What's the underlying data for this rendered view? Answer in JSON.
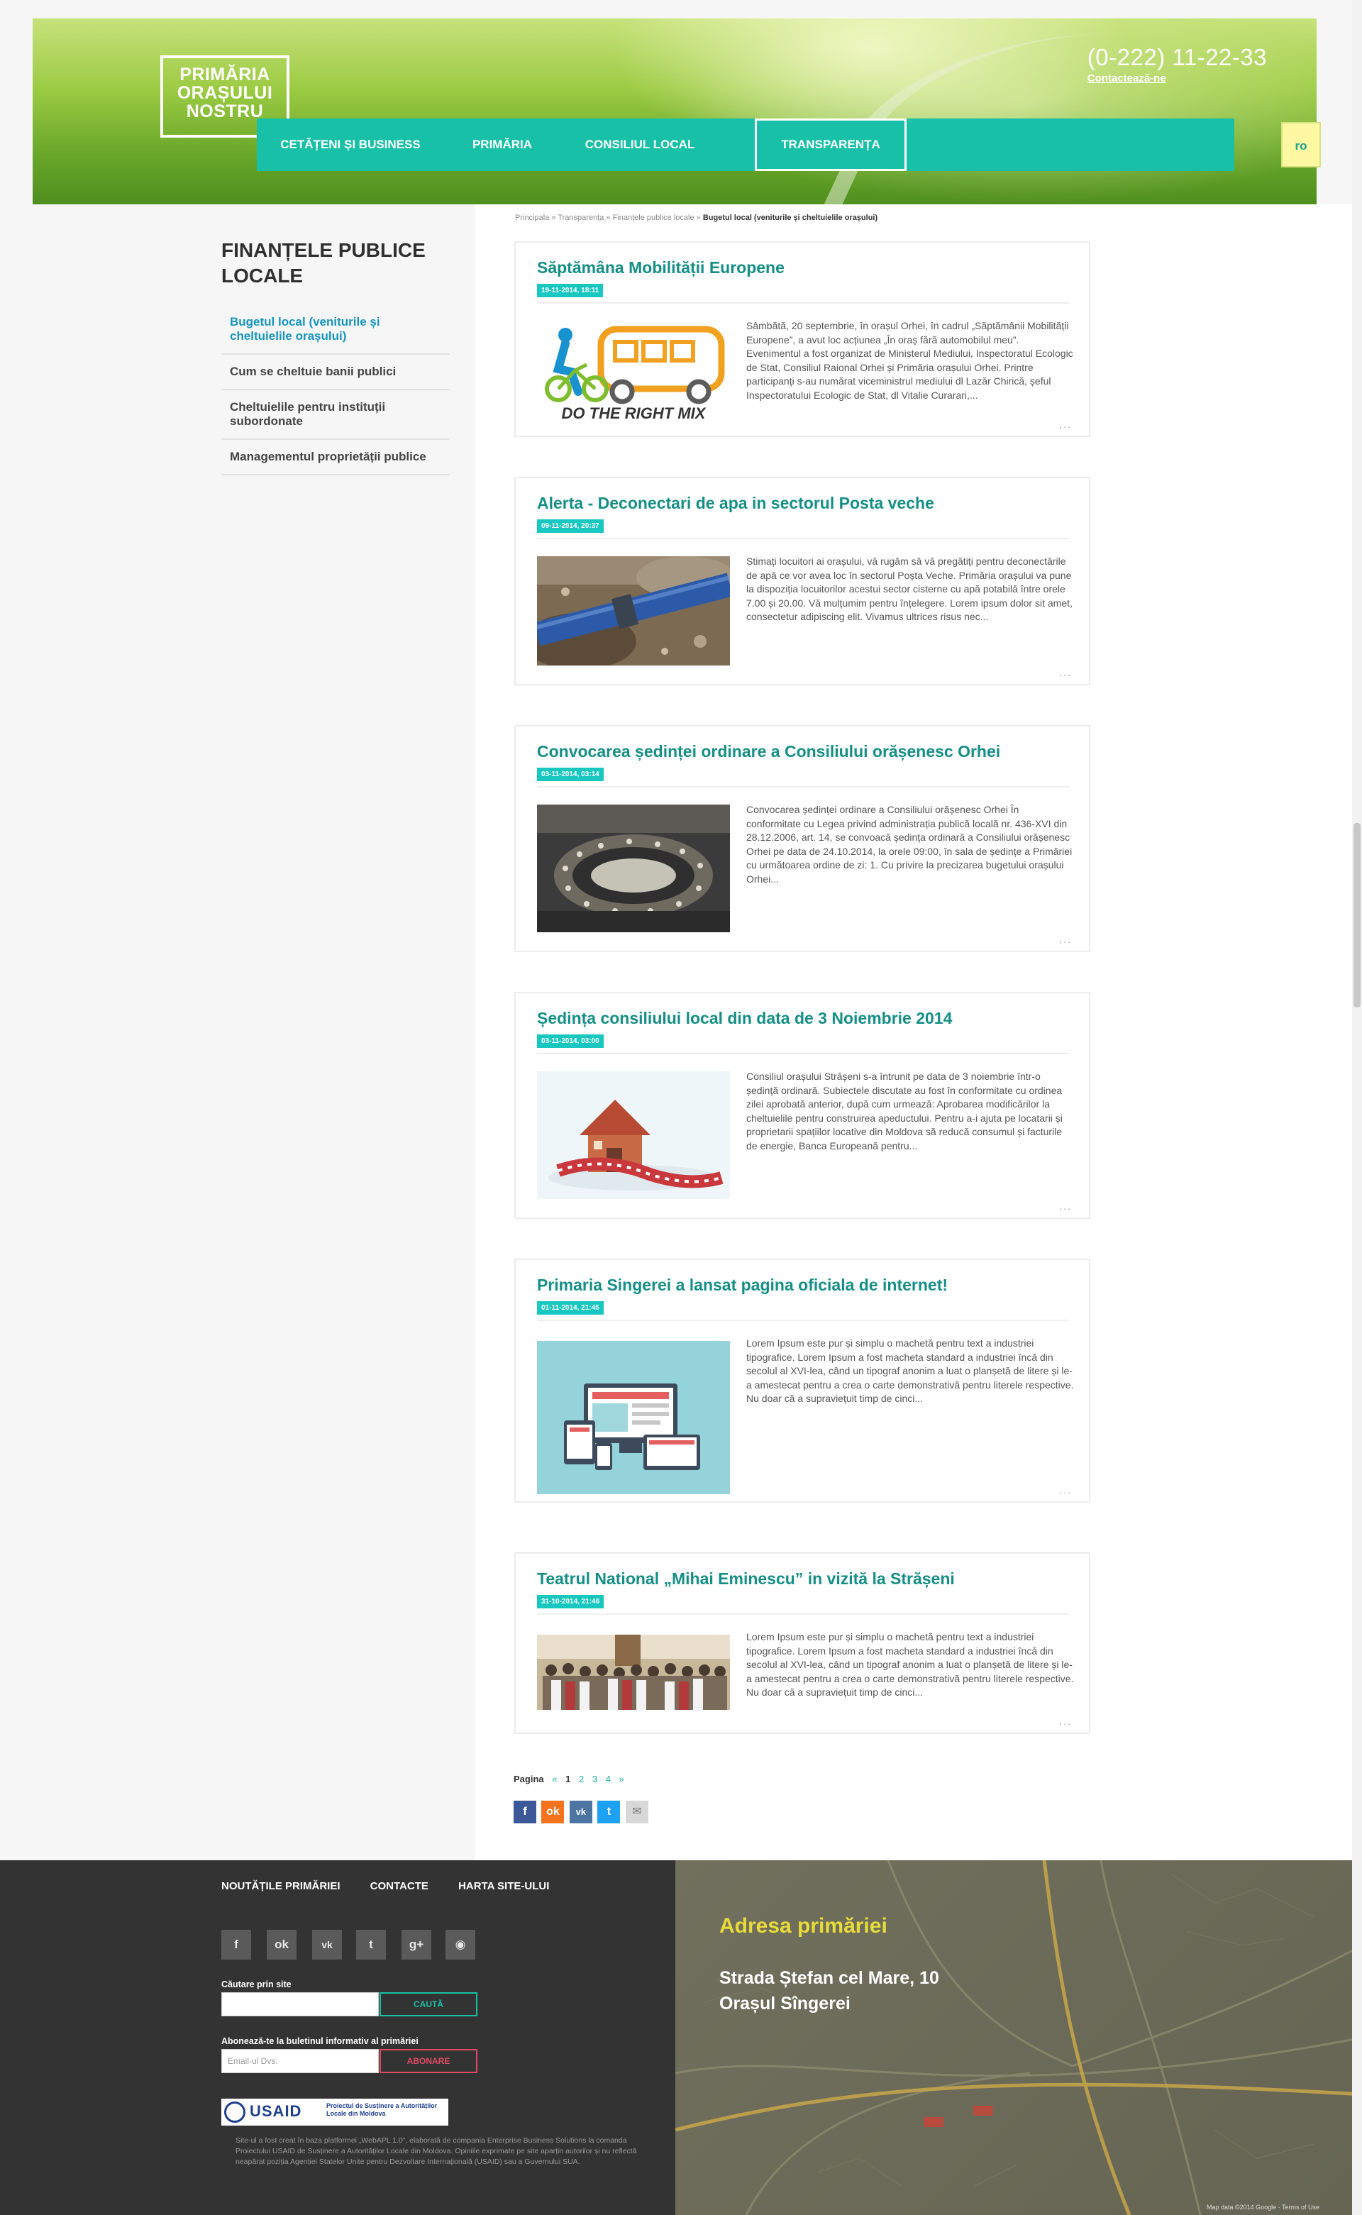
{
  "header": {
    "logo_line1": "PRIMĂRIA",
    "logo_line2": "ORAȘULUI",
    "logo_line3": "NOSTRU",
    "phone": "(0-222) 11-22-33",
    "contact_link": "Contactează-ne",
    "nav": [
      "CETĂȚENI ȘI BUSINESS",
      "PRIMĂRIA",
      "CONSILIUL LOCAL",
      "TRANSPARENȚA"
    ],
    "lang": "ro",
    "accent_color": "#17c0a6"
  },
  "breadcrumb": {
    "items": [
      "Principala",
      "Transparența",
      "Finanțele publice locale"
    ],
    "current": "Bugetul local (veniturile și cheltuielile orașului)"
  },
  "sidebar": {
    "title": "FINANȚELE PUBLICE LOCALE",
    "items": [
      "Bugetul local (veniturile și cheltuielile orașului)",
      "Cum se cheltuie banii publici",
      "Cheltuielile pentru instituții subordonate",
      "Managementul proprietății publice"
    ]
  },
  "articles": [
    {
      "title": "Săptămâna Mobilității Europene",
      "date": "19-11-2014, 18:11",
      "image_caption": "DO THE RIGHT MIX",
      "text": "Sâmbătă, 20 septembrie, în orașul Orhei, în cadrul „Săptămânii Mobilității Europene”, a avut loc acțiunea „În oraș fără automobilul meu”. Evenimentul a fost organizat de Ministerul Mediului, Inspectoratul Ecologic de Stat, Consiliul Raional Orhei și Primăria orașului Orhei. Printre participanți s-au numărat viceministrul mediului dl Lazăr Chirică, șeful Inspectoratului Ecologic de Stat, dl Vitalie Curarari,...",
      "more": "..."
    },
    {
      "title": "Alerta - Deconectari de apa in sectorul Posta veche",
      "date": "09-11-2014, 20:37",
      "text": "Stimați locuitori ai orașului, vă rugăm să vă pregătiți pentru deconectările de apă ce vor avea loc în sectorul Poșta Veche. Primăria orașului va pune la dispoziția locuitorilor acestui sector cisterne cu apă potabilă între orele 7.00 și 20.00. Vă mulțumim pentru înțelegere. Lorem ipsum dolor sit amet, consectetur adipiscing elit. Vivamus ultrices risus nec...",
      "more": "..."
    },
    {
      "title": "Convocarea ședinței ordinare a Consiliului orășenesc Orhei",
      "date": "03-11-2014, 03:14",
      "text": "Convocarea ședinței ordinare a Consiliului orășenesc Orhei În conformitate cu Legea privind administrația publică locală nr. 436-XVI din 28.12.2006, art. 14, se convoacă ședința ordinară a Consiliului orășenesc Orhei pe data de 24.10.2014, la orele 09:00, în sala de ședințe a Primăriei cu următoarea ordine de zi: 1. Cu privire la precizarea bugetului orașului Orhei...",
      "more": "..."
    },
    {
      "title": "Ședința consiliului local din data de 3 Noiembrie 2014",
      "date": "03-11-2014, 03:00",
      "text": "Consiliul orașului Strășeni s-a întrunit pe data de 3 noiembrie într-o ședință ordinară. Subiectele discutate au fost în conformitate cu ordinea zilei aprobată anterior, după cum urmează: Aprobarea modificărilor la cheltuielile pentru construirea apeductului. Pentru a-i ajuta pe locatarii și proprietarii spațiilor locative din Moldova să reducă consumul și facturile de energie, Banca Europeană pentru...",
      "more": "..."
    },
    {
      "title": "Primaria Singerei a lansat pagina oficiala de internet!",
      "date": "01-11-2014, 21:45",
      "text": "Lorem Ipsum este pur și simplu o machetă pentru text a industriei tipografice. Lorem Ipsum a fost macheta standard a industriei încă din secolul al XVI-lea, când un tipograf anonim a luat o planșetă de litere și le-a amestecat pentru a crea o carte demonstrativă pentru literele respective. Nu doar că a supraviețuit timp de cinci...",
      "more": "..."
    },
    {
      "title": "Teatrul National „Mihai Eminescu” in vizită la Strășeni",
      "date": "31-10-2014, 21:46",
      "text": "Lorem Ipsum este pur și simplu o machetă pentru text a industriei tipografice. Lorem Ipsum a fost macheta standard a industriei încă din secolul al XVI-lea, când un tipograf anonim a luat o planșetă de litere și le-a amestecat pentru a crea o carte demonstrativă pentru literele respective. Nu doar că a supraviețuit timp de cinci...",
      "more": "..."
    }
  ],
  "pagination": {
    "label": "Pagina",
    "prev": "«",
    "pages": [
      "1",
      "2",
      "3",
      "4"
    ],
    "current": "1",
    "next": "»"
  },
  "share": {
    "icons": [
      "facebook-icon",
      "odnoklassniki-icon",
      "vk-icon",
      "twitter-icon",
      "email-icon"
    ],
    "colors": [
      "#3b5998",
      "#f4731c",
      "#4c75a3",
      "#1da1f2",
      "#d8d8d8"
    ]
  },
  "footer": {
    "links": [
      "NOUTĂȚILE PRIMĂRIEI",
      "CONTACTE",
      "HARTA SITE-ULUI"
    ],
    "social_icons": [
      "facebook-icon",
      "odnoklassniki-icon",
      "vk-icon",
      "twitter-icon",
      "googleplus-icon",
      "rss-icon"
    ],
    "search_label": "Căutare prin site",
    "search_button": "CAUTĂ",
    "newsletter_label": "Abonează-te la buletinul informativ al primăriei",
    "email_placeholder": "Email-ul Dvs.",
    "subscribe_button": "ABONARE",
    "usaid_name": "USAID",
    "usaid_project": "Proiectul de Susținere a Autorităților Locale din Moldova",
    "credits": "Site-ul a fost creat în baza platformei „WebAPL 1.0”, elaborată de compania Enterprise Business Solutions la comanda Proiectului USAID de Susținere a Autorităților Locale din Moldova. Opiniile exprimate pe site aparțin autorilor și nu reflectă neapărat poziția Agenției Statelor Unite pentru Dezvoltare Internațională (USAID) sau a Guvernului SUA."
  },
  "map": {
    "heading": "Adresa primăriei",
    "street": "Strada Ștefan cel Mare, 10",
    "city": "Orașul Sîngerei",
    "credits": "Map data ©2014 Google · Terms of Use"
  }
}
